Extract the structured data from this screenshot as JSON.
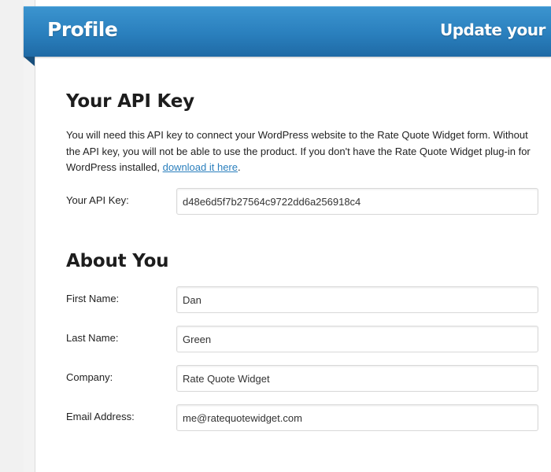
{
  "header": {
    "title": "Profile",
    "right_text": "Update your me"
  },
  "api_section": {
    "heading": "Your API Key",
    "intro_text": "You will need this API key to connect your WordPress website to the Rate Quote Widget form. Without the API key, you will not be able to use the product. If you don't have the Rate Quote Widget plug-in for WordPress installed, ",
    "link_text": "download it here",
    "intro_end": ".",
    "api_key_label": "Your API Key:",
    "api_key_value": "d48e6d5f7b27564c9722dd6a256918c4"
  },
  "about_section": {
    "heading": "About You",
    "first_name_label": "First Name:",
    "first_name_value": "Dan",
    "last_name_label": "Last Name:",
    "last_name_value": "Green",
    "company_label": "Company:",
    "company_value": "Rate Quote Widget",
    "email_label": "Email Address:",
    "email_value": "me@ratequotewidget.com"
  },
  "colors": {
    "header_blue": "#2a7fbd",
    "link_blue": "#2a7fbd"
  }
}
